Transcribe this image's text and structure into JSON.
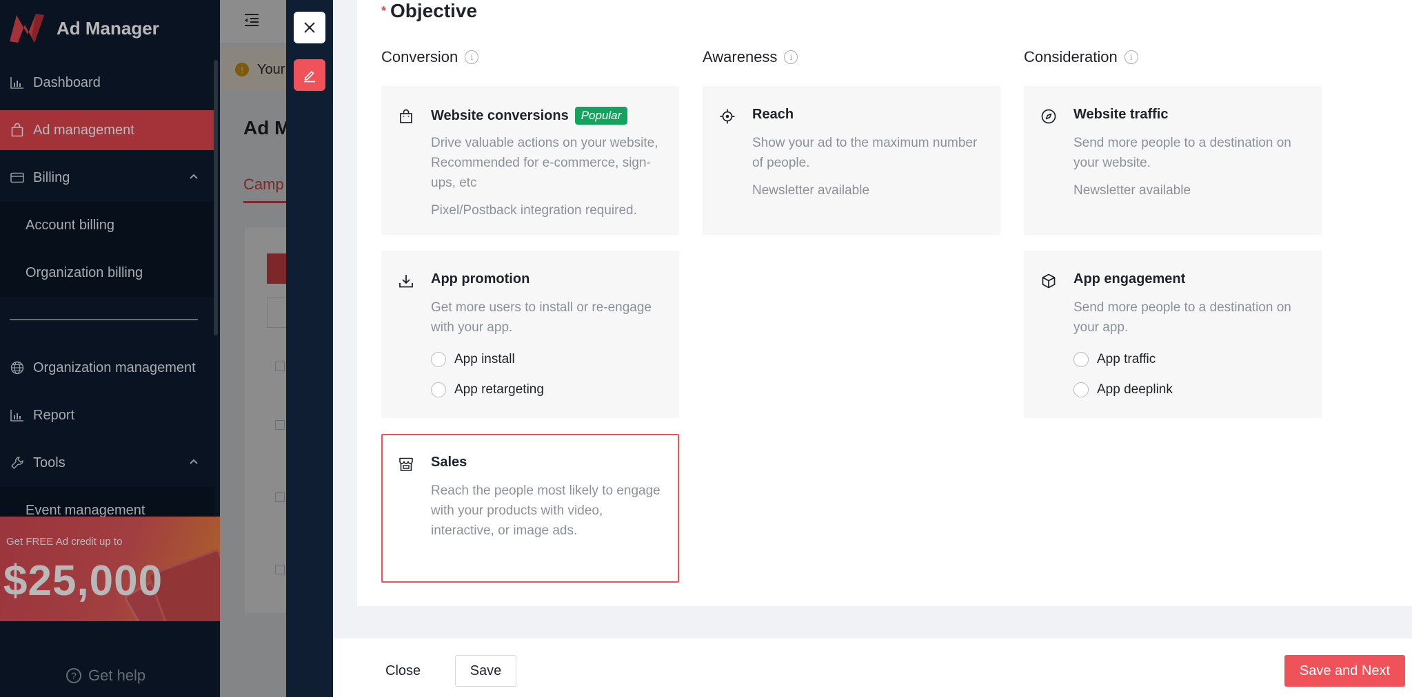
{
  "app": {
    "title": "Ad Manager"
  },
  "sidebar": {
    "items": [
      {
        "label": "Dashboard",
        "icon": "bar-chart-icon"
      },
      {
        "label": "Ad management",
        "icon": "bag-icon",
        "active": true
      },
      {
        "label": "Billing",
        "icon": "wallet-icon",
        "expanded": true
      },
      {
        "label": "Organization management",
        "icon": "globe-icon"
      },
      {
        "label": "Report",
        "icon": "bar-chart-icon"
      },
      {
        "label": "Tools",
        "icon": "wrench-icon",
        "expanded": true
      }
    ],
    "billing_sub": [
      "Account billing",
      "Organization billing"
    ],
    "tools_sub": [
      "Event management"
    ],
    "promo": {
      "small": "Get FREE Ad credit up to",
      "big": "$25,000"
    },
    "help": "Get help",
    "accent": "#e3474f"
  },
  "background_page": {
    "warning_fragment": "Your",
    "title_fragment": "Ad M",
    "tab_fragment": "Camp"
  },
  "drawer": {
    "section_title": "Objective",
    "required_mark": "*",
    "columns": [
      {
        "title": "Conversion"
      },
      {
        "title": "Awareness"
      },
      {
        "title": "Consideration"
      }
    ],
    "cards": {
      "website_conversions": {
        "title": "Website conversions",
        "badge": "Popular",
        "description": "Drive valuable actions on your website, Recommended for e-commerce, sign-ups, etc",
        "note": "Pixel/Postback integration required.",
        "icon": "shopping-bag-icon"
      },
      "reach": {
        "title": "Reach",
        "description": "Show your ad to the maximum number of people.",
        "note": "Newsletter available",
        "icon": "target-icon"
      },
      "website_traffic": {
        "title": "Website traffic",
        "description": "Send more people to a destination on your website.",
        "note": "Newsletter available",
        "icon": "compass-icon"
      },
      "app_promotion": {
        "title": "App promotion",
        "description": "Get more users to install or re-engage with your app.",
        "options": [
          "App install",
          "App retargeting"
        ],
        "icon": "download-icon"
      },
      "app_engagement": {
        "title": "App engagement",
        "description": "Send more people to a destination on your app.",
        "options": [
          "App traffic",
          "App deeplink"
        ],
        "icon": "cube-icon"
      },
      "sales": {
        "title": "Sales",
        "description": "Reach the people most likely to engage with your products with video, interactive, or image ads.",
        "selected": true,
        "icon": "storefront-icon"
      }
    },
    "footer": {
      "close": "Close",
      "save": "Save",
      "save_next": "Save and Next"
    },
    "accent": "#f0525a",
    "badge_color": "#14a35f"
  }
}
